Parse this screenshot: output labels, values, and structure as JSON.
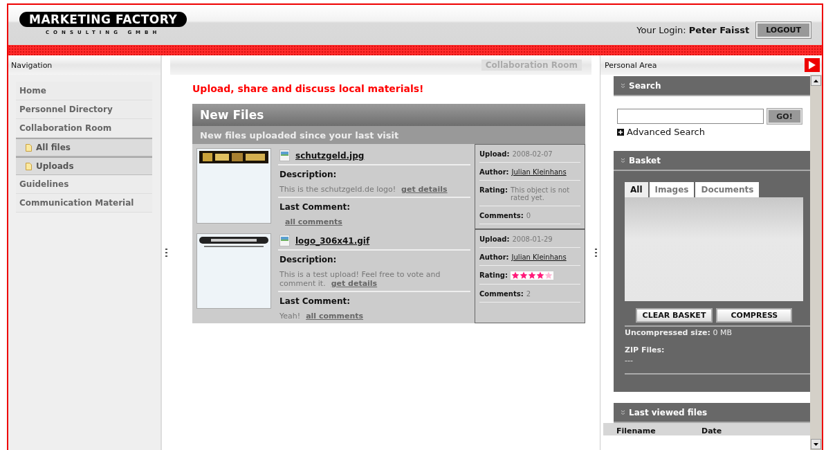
{
  "header": {
    "logo_title": "MARKETING FACTORY",
    "logo_subtitle": "CONSULTING GMBH",
    "login_label": "Your Login:",
    "login_user": "Peter Faisst",
    "logout": "LOGOUT"
  },
  "navigation": {
    "title": "Navigation",
    "items": [
      {
        "label": "Home"
      },
      {
        "label": "Personnel Directory"
      },
      {
        "label": "Collaboration Room",
        "expanded": true,
        "children": [
          {
            "label": "All files"
          },
          {
            "label": "Uploads"
          }
        ]
      },
      {
        "label": "Guidelines"
      },
      {
        "label": "Communication Material"
      }
    ]
  },
  "content": {
    "breadcrumb": "Collaboration Room",
    "heading": "Upload, share and discuss local materials!",
    "panel": {
      "title": "New Files",
      "subtitle": "New files uploaded since your last visit",
      "files": [
        {
          "name": "schutzgeld.jpg",
          "description_label": "Description:",
          "description": "This is the schutzgeld.de logo!",
          "details_link": "get details",
          "comment_label": "Last Comment:",
          "comments_link": "all comments",
          "upload_label": "Upload:",
          "upload": "2008-02-07",
          "author_label": "Author:",
          "author": "Julian Kleinhans",
          "rating_label": "Rating:",
          "rating_text": "This object is not rated yet.",
          "count_label": "Comments:",
          "count": "0"
        },
        {
          "name": "logo_306x41.gif",
          "description_label": "Description:",
          "description": "This is a test upload! Feel free to vote and comment it.",
          "details_link": "get details",
          "comment_label": "Last Comment:",
          "comment": "Yeah!",
          "comments_link": "all comments",
          "upload_label": "Upload:",
          "upload": "2008-01-29",
          "author_label": "Author:",
          "author": "Julian Kleinhans",
          "rating_label": "Rating:",
          "stars": 4,
          "count_label": "Comments:",
          "count": "2"
        }
      ]
    }
  },
  "personal_area": {
    "title": "Personal Area",
    "search": {
      "title": "Search",
      "button": "GO!",
      "advanced": "Advanced Search"
    },
    "basket": {
      "title": "Basket",
      "tabs": [
        {
          "label": "All",
          "selected": true
        },
        {
          "label": "Images",
          "selected": false
        },
        {
          "label": "Documents",
          "selected": false
        }
      ],
      "buttons": [
        "CLEAR BASKET",
        "COMPRESS"
      ],
      "size_label": "Uncompressed size:",
      "size": "0 MB",
      "zip_label": "ZIP Files:",
      "zip": "---"
    },
    "last_viewed": {
      "title": "Last viewed files",
      "columns": [
        "Filename",
        "Date"
      ]
    }
  }
}
